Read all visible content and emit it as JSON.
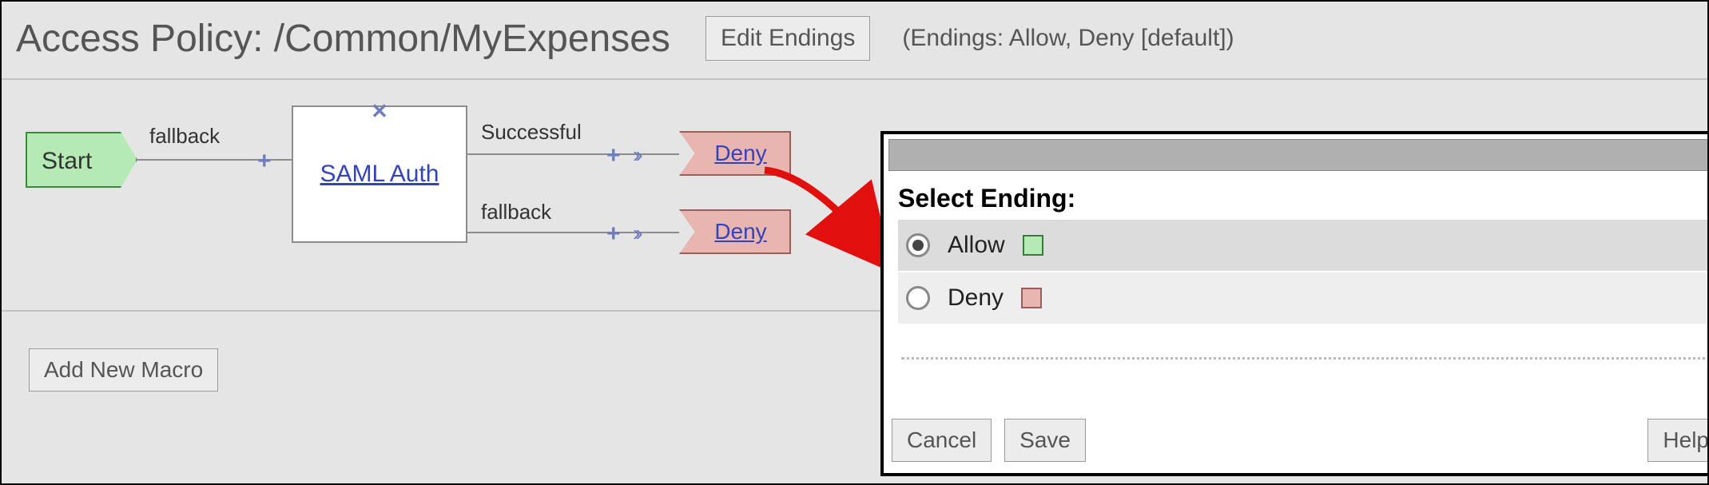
{
  "header": {
    "title": "Access Policy: /Common/MyExpenses",
    "edit_endings_label": "Edit Endings",
    "endings_summary": "(Endings: Allow, Deny [default])"
  },
  "flow": {
    "start_label": "Start",
    "branch_fallback_1": "fallback",
    "node_link": "SAML Auth",
    "branch_successful": "Successful",
    "branch_fallback_2": "fallback",
    "end1_label": "Deny",
    "end2_label": "Deny",
    "plus_glyph": "+",
    "dbl_arrow_glyph": "››"
  },
  "footer": {
    "add_macro_label": "Add New Macro"
  },
  "dialog": {
    "heading": "Select Ending:",
    "option_allow": "Allow",
    "option_deny": "Deny",
    "cancel_label": "Cancel",
    "save_label": "Save",
    "help_label": "Help"
  }
}
